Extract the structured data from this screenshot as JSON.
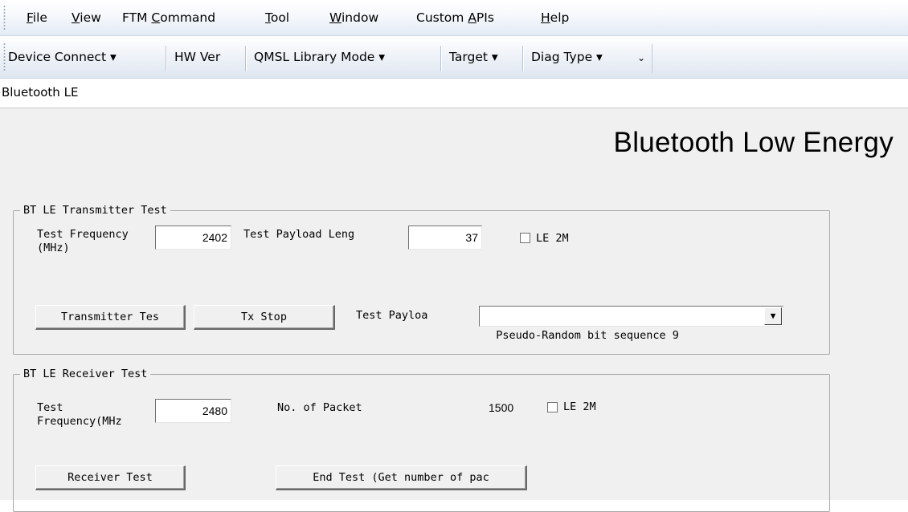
{
  "menu": [
    {
      "pre": "",
      "accel": "F",
      "post": "ile"
    },
    {
      "pre": "",
      "accel": "V",
      "post": "iew"
    },
    {
      "pre": "FTM ",
      "accel": "C",
      "post": "ommand"
    },
    {
      "pre": "",
      "accel": "T",
      "post": "ool"
    },
    {
      "pre": "",
      "accel": "W",
      "post": "indow"
    },
    {
      "pre": "Custom ",
      "accel": "A",
      "post": "PIs"
    },
    {
      "pre": "",
      "accel": "H",
      "post": "elp"
    }
  ],
  "toolbar": {
    "device_connect": "Device Connect ▾",
    "hw_ver": "HW Ver",
    "qmsl_library_mode": "QMSL Library Mode ▾",
    "target": "Target ▾",
    "diag_type": "Diag Type ▾",
    "overflow": "⌄"
  },
  "tab_label": "Bluetooth LE",
  "page_title": "Bluetooth Low Energy",
  "tx": {
    "legend": "BT LE Transmitter Test",
    "freq_label_line1": "Test Frequency",
    "freq_label_line2": "(MHz)",
    "freq_value": "2402",
    "payload_len_label": "Test Payload Leng",
    "payload_len_value": "37",
    "le2m_label": "LE 2M",
    "le2m_checked": false,
    "transmitter_test_button": "Transmitter Tes",
    "tx_stop_button": "Tx Stop",
    "payload_label": "Test Payloa",
    "payload_selected": "Pseudo-Random bit sequence 9",
    "dropdown_arrow": "▼"
  },
  "rx": {
    "legend": "BT LE Receiver Test",
    "freq_label_line1": "Test",
    "freq_label_line2": "Frequency(MHz",
    "freq_value": "2480",
    "packets_label": "No. of Packet",
    "packets_value": "1500",
    "le2m_label": "LE 2M",
    "le2m_checked": false,
    "receiver_test_button": "Receiver Test",
    "end_test_button": "End Test (Get number of pac"
  }
}
